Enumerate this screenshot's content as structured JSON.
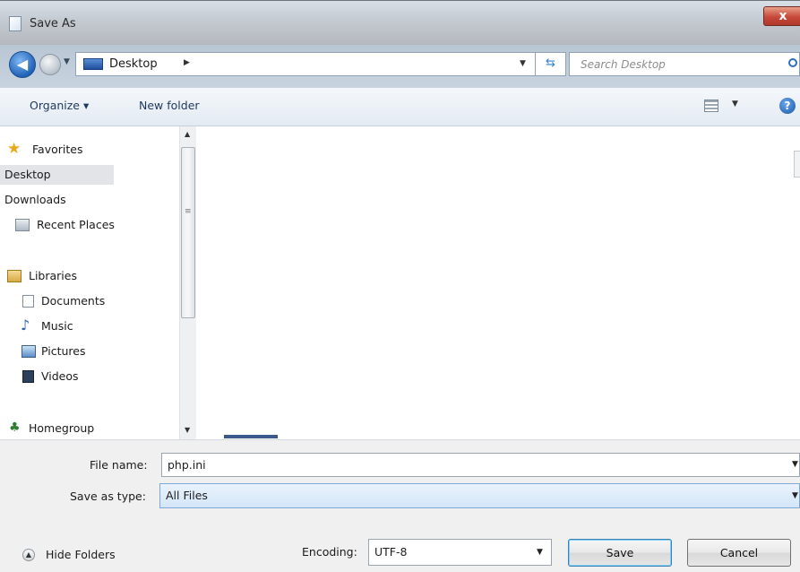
{
  "window": {
    "title": "Save As",
    "close_glyph": "x"
  },
  "address_bar": {
    "location": "Desktop",
    "search_placeholder": "Search Desktop"
  },
  "toolbar": {
    "organize_label": "Organize ▾",
    "new_folder_label": "New folder"
  },
  "nav_pane": {
    "favorites_header": "Favorites",
    "favorites": [
      {
        "label": "Desktop",
        "icon": "desktop-icon",
        "selected": true
      },
      {
        "label": "Downloads",
        "icon": "downloads-icon"
      },
      {
        "label": "Recent Places",
        "icon": "recent-places-icon"
      }
    ],
    "libraries_header": "Libraries",
    "libraries": [
      {
        "label": "Documents",
        "icon": "documents-icon"
      },
      {
        "label": "Music",
        "icon": "music-icon"
      },
      {
        "label": "Pictures",
        "icon": "pictures-icon"
      },
      {
        "label": "Videos",
        "icon": "videos-icon"
      }
    ],
    "homegroup": "Homegroup"
  },
  "form": {
    "file_name_label": "File name:",
    "file_name_value": "php.ini",
    "save_as_type_label": "Save as type:",
    "save_as_type_value": "All Files",
    "encoding_label": "Encoding:",
    "encoding_value": "UTF-8"
  },
  "buttons": {
    "hide_folders": "Hide Folders",
    "save": "Save",
    "cancel": "Cancel"
  },
  "colors": {
    "accent": "#3c7fb1",
    "selection": "#d3e6f8",
    "toolbar_text": "#1e395b"
  }
}
